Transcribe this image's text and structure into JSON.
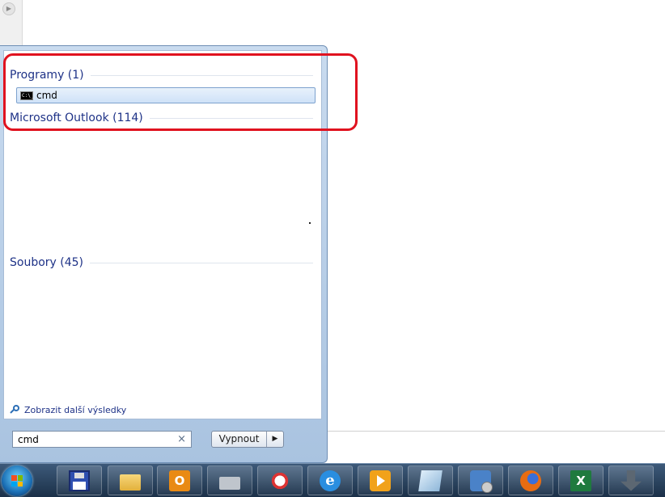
{
  "start_menu": {
    "groups": {
      "programs": "Programy (1)",
      "outlook": "Microsoft Outlook (114)",
      "files": "Soubory (45)"
    },
    "result_item": "cmd",
    "cmd_icon_text": "C:\\_",
    "more_results": "Zobrazit další výsledky",
    "search_value": "cmd",
    "clear_symbol": "×",
    "shutdown_label": "Vypnout",
    "shutdown_arrow": "▶"
  },
  "annotation": {
    "color": "#e0121f"
  },
  "taskbar": {
    "items": [
      "floppy-save-icon",
      "file-explorer-icon",
      "outlook-icon",
      "printer-icon",
      "snipping-tool-icon",
      "internet-explorer-icon",
      "media-center-icon",
      "notes-icon",
      "network-icon",
      "firefox-icon",
      "excel-icon",
      "download-icon"
    ],
    "outlook_letter": "O",
    "ie_letter": "e",
    "excel_letter": "X"
  }
}
